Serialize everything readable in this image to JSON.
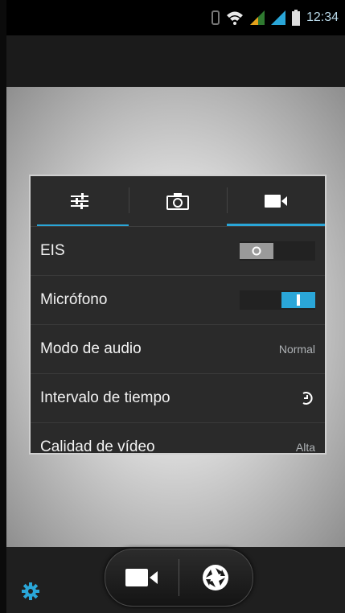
{
  "status_bar": {
    "time": "12:34"
  },
  "panel": {
    "tabs": [
      {
        "icon": "sliders-icon"
      },
      {
        "icon": "camera-icon"
      },
      {
        "icon": "video-camera-icon",
        "selected": true
      }
    ],
    "rows": [
      {
        "label": "EIS",
        "control": "toggle",
        "state": "off"
      },
      {
        "label": "Micrófono",
        "control": "toggle",
        "state": "on"
      },
      {
        "label": "Modo de audio",
        "value": "Normal"
      },
      {
        "label": "Intervalo de tiempo",
        "control": "timer-icon"
      },
      {
        "label": "Calidad de vídeo",
        "value": "Alta"
      }
    ]
  },
  "bottom": {
    "settings_icon": "gear-icon",
    "buttons": [
      {
        "icon": "video-camera-icon"
      },
      {
        "icon": "shutter-icon"
      }
    ]
  },
  "colors": {
    "accent": "#2aa6d8"
  }
}
